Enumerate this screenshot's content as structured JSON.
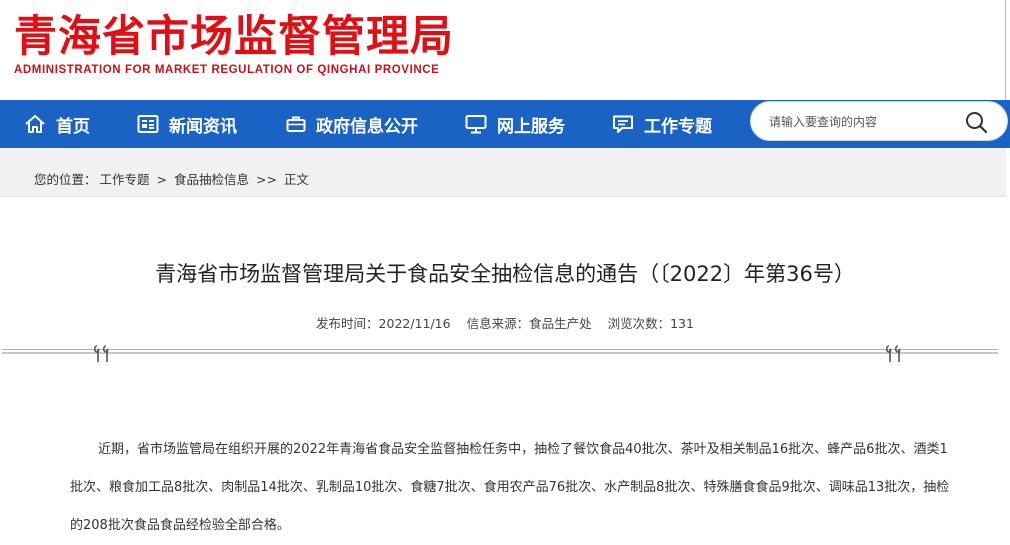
{
  "header": {
    "title_cn": "青海省市场监督管理局",
    "title_en": "ADMINISTRATION FOR MARKET REGULATION OF QINGHAI PROVINCE"
  },
  "nav": {
    "items": [
      {
        "label": "首页",
        "icon": "home-icon"
      },
      {
        "label": "新闻资讯",
        "icon": "news-icon"
      },
      {
        "label": "政府信息公开",
        "icon": "briefcase-icon"
      },
      {
        "label": "网上服务",
        "icon": "monitor-icon"
      },
      {
        "label": "工作专题",
        "icon": "chat-icon"
      }
    ],
    "search_placeholder": "请输入要查询的内容"
  },
  "breadcrumb": {
    "prefix": "您的位置：",
    "items": [
      "工作专题",
      "食品抽检信息",
      "正文"
    ],
    "sep1": ">",
    "sep2": ">>"
  },
  "article": {
    "title": "青海省市场监督管理局关于食品安全抽检信息的通告（〔2022〕年第36号）",
    "publish_label": "发布时间：",
    "publish_date": "2022/11/16",
    "source_label": "信息来源：",
    "source": "食品生产处",
    "views_label": "浏览次数：",
    "views": "131",
    "body": "近期，省市场监管局在组织开展的2022年青海省食品安全监督抽检任务中，抽检了餐饮食品40批次、茶叶及相关制品16批次、蜂产品6批次、酒类1批次、粮食加工品8批次、肉制品14批次、乳制品10批次、食糖7批次、食用农产品76批次、水产制品8批次、特殊膳食食品9批次、调味品13批次，抽检的208批次食品食品经检验全部合格。"
  },
  "colors": {
    "brand_red": "#e10f14",
    "nav_blue": "#1a63c5"
  }
}
